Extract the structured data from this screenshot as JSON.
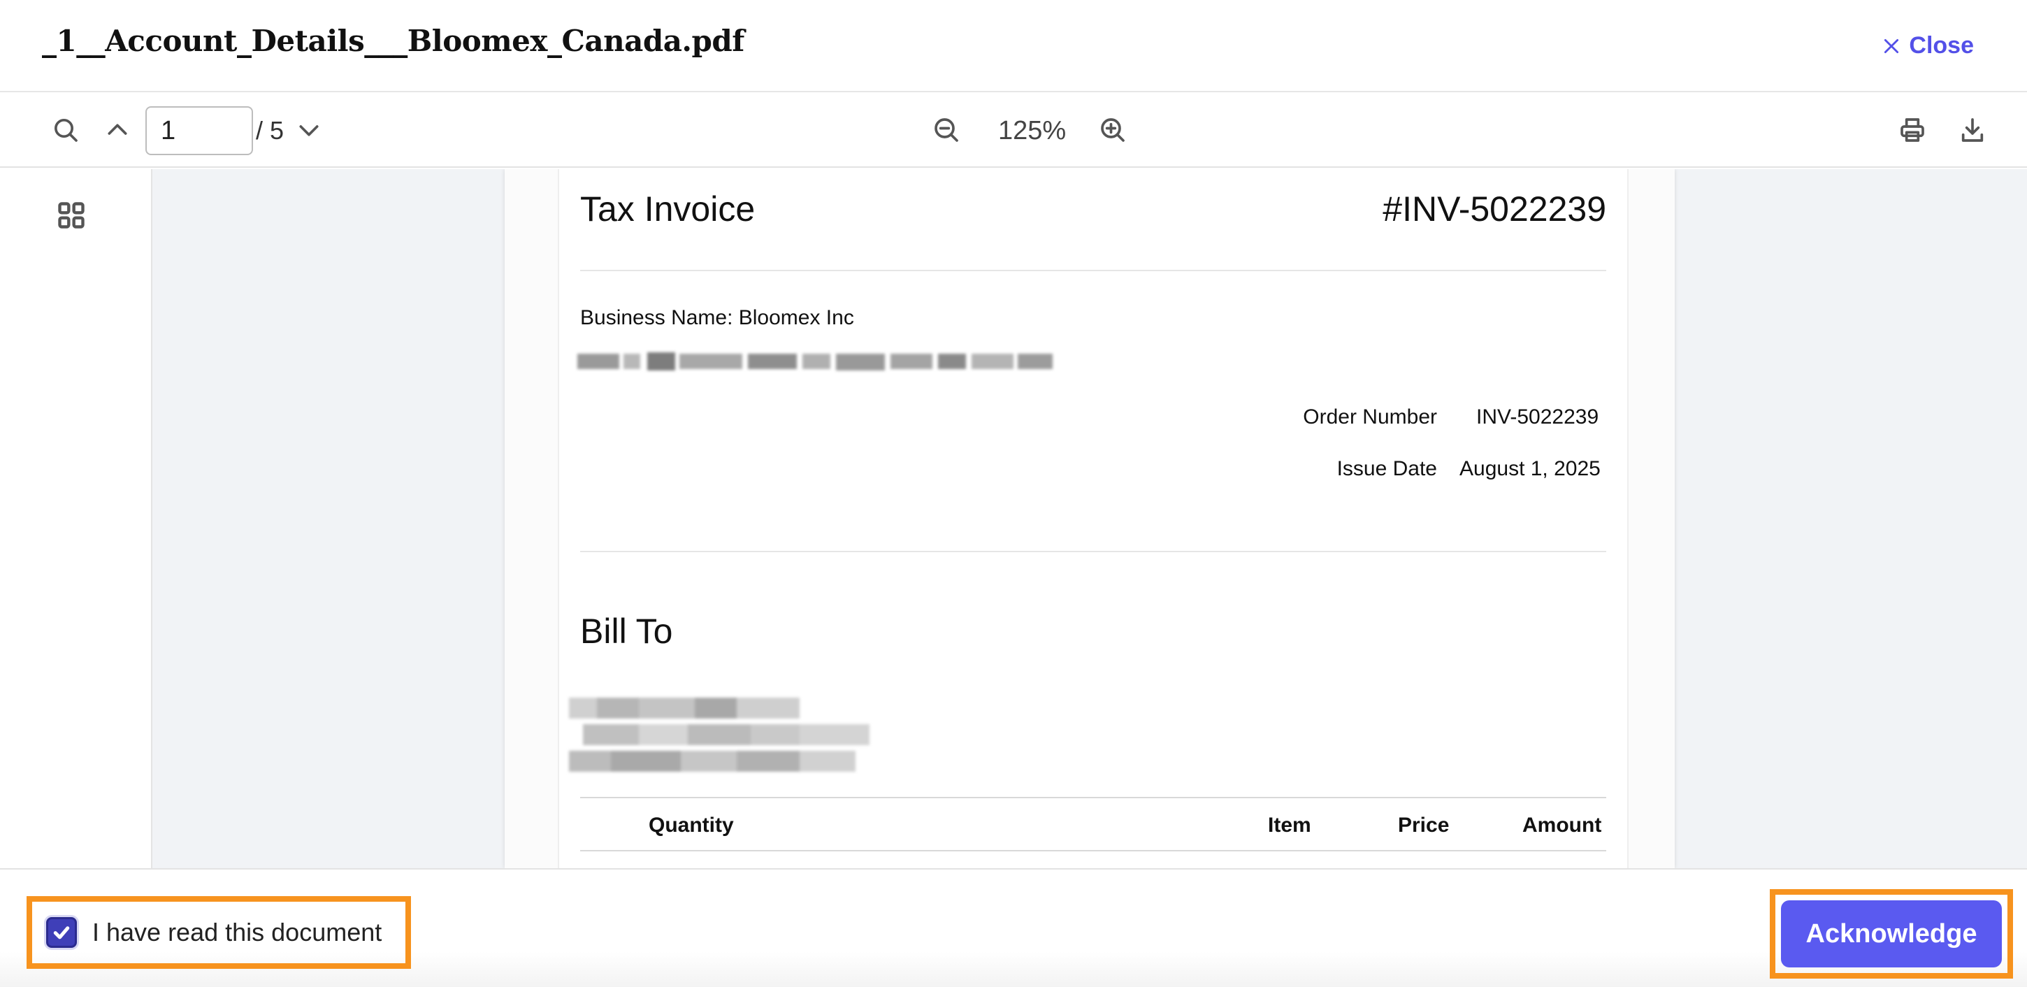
{
  "header": {
    "title": "_1__Account_Details___Bloomex_Canada.pdf",
    "close_label": "Close"
  },
  "toolbar": {
    "page_current": "1",
    "page_total": "/ 5",
    "zoom": "125%"
  },
  "document": {
    "title": "Tax Invoice",
    "number": "#INV-5022239",
    "business_name": "Business Name: Bloomex Inc",
    "order_number_label": "Order Number",
    "order_number_value": "INV-5022239",
    "issue_date_label": "Issue Date",
    "issue_date_value": "August 1, 2025",
    "bill_to": "Bill To",
    "table_headers": [
      "Quantity",
      "Item",
      "Price",
      "Amount"
    ]
  },
  "footer": {
    "read_label": "I have read this document",
    "read_checked": true,
    "acknowledge_label": "Acknowledge"
  },
  "colors": {
    "accent": "#5a5af0",
    "highlight": "#f7931e",
    "checkbox": "#3f3fb8"
  },
  "icons": [
    "close-icon",
    "search-icon",
    "chevron-up-icon",
    "chevron-down-icon",
    "zoom-out-icon",
    "zoom-in-icon",
    "print-icon",
    "download-icon",
    "thumbnails-grid-icon",
    "checkmark-icon"
  ]
}
